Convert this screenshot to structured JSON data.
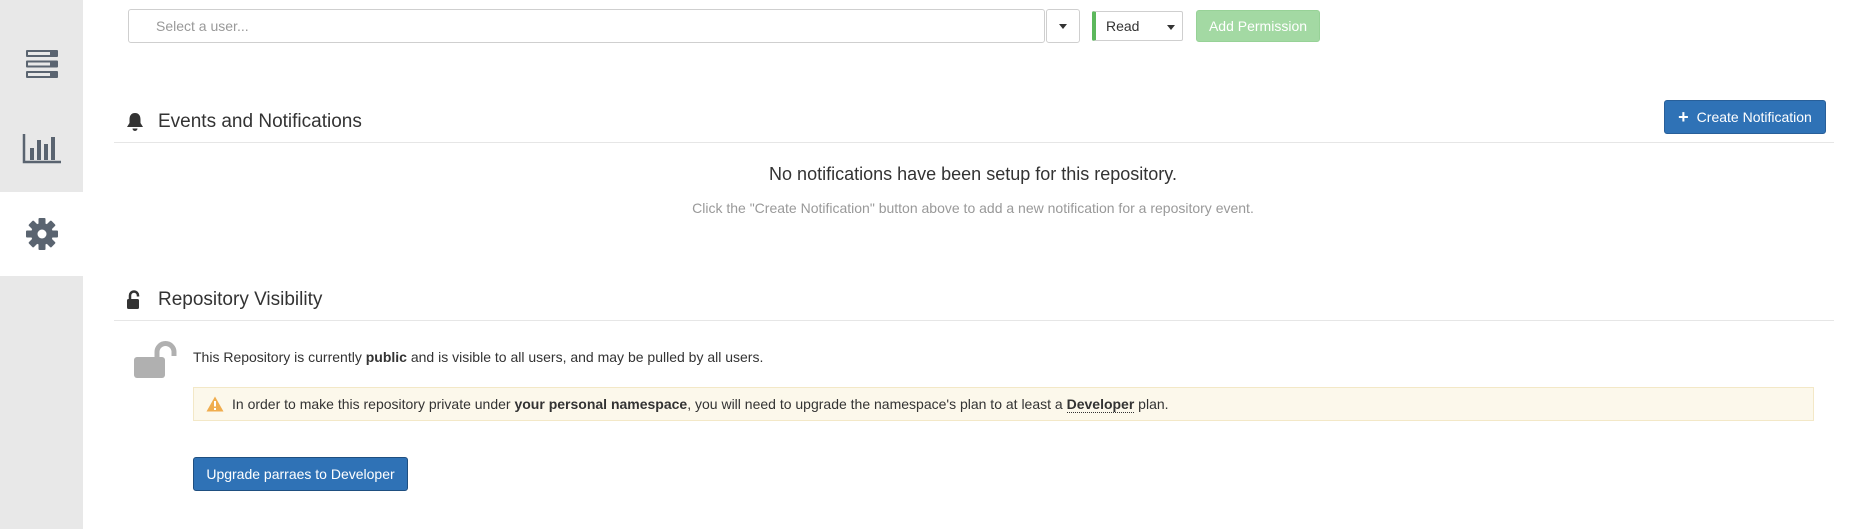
{
  "sidebar": {
    "items": [
      {
        "icon": "server-icon",
        "active": false
      },
      {
        "icon": "bar-chart-icon",
        "active": false
      },
      {
        "icon": "gear-icon",
        "active": true
      }
    ]
  },
  "permissions": {
    "user_placeholder": "Select a user...",
    "role_value": "Read",
    "add_button": "Add Permission"
  },
  "notifications": {
    "title": "Events and Notifications",
    "create_button": "Create Notification",
    "empty_title": "No notifications have been setup for this repository.",
    "empty_hint": "Click the \"Create Notification\" button above to add a new notification for a repository event."
  },
  "visibility": {
    "title": "Repository Visibility",
    "status_prefix": "This Repository is currently ",
    "status_value": "public",
    "status_suffix": " and is visible to all users, and may be pulled by all users.",
    "warning_prefix": "In order to make this repository private under ",
    "warning_bold": "your personal namespace",
    "warning_middle": ", you will need to upgrade the namespace's plan to at least a ",
    "warning_plan": "Developer",
    "warning_suffix": " plan.",
    "upgrade_button": "Upgrade parraes to Developer"
  },
  "colors": {
    "primary": "#2f72b6",
    "success_disabled": "#a3d9a3",
    "role_accent": "#5cb85c",
    "warning_bg": "#fcf8eb",
    "warning_icon": "#f0ad4e",
    "sidebar_bg": "#e8e8e8"
  }
}
